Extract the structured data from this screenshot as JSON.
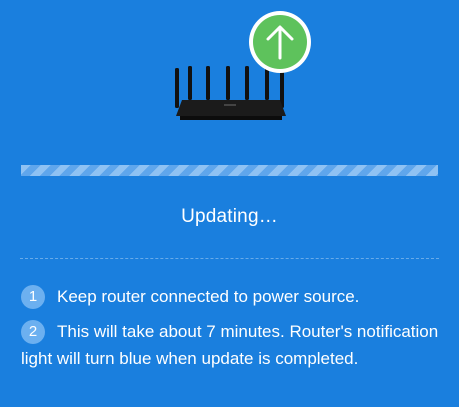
{
  "status": {
    "text": "Updating…"
  },
  "update_badge": {
    "icon": "arrow-up-icon",
    "color": "#5ec25c"
  },
  "progress": {
    "percent": null
  },
  "notes": [
    {
      "number": "1",
      "text": "Keep router connected to power source."
    },
    {
      "number": "2",
      "text": "This will take about 7 minutes. Router's notification light will turn blue when update is completed."
    }
  ],
  "colors": {
    "background": "#1a7fde",
    "badge": "#6cb0f0",
    "accent": "#5ec25c"
  }
}
